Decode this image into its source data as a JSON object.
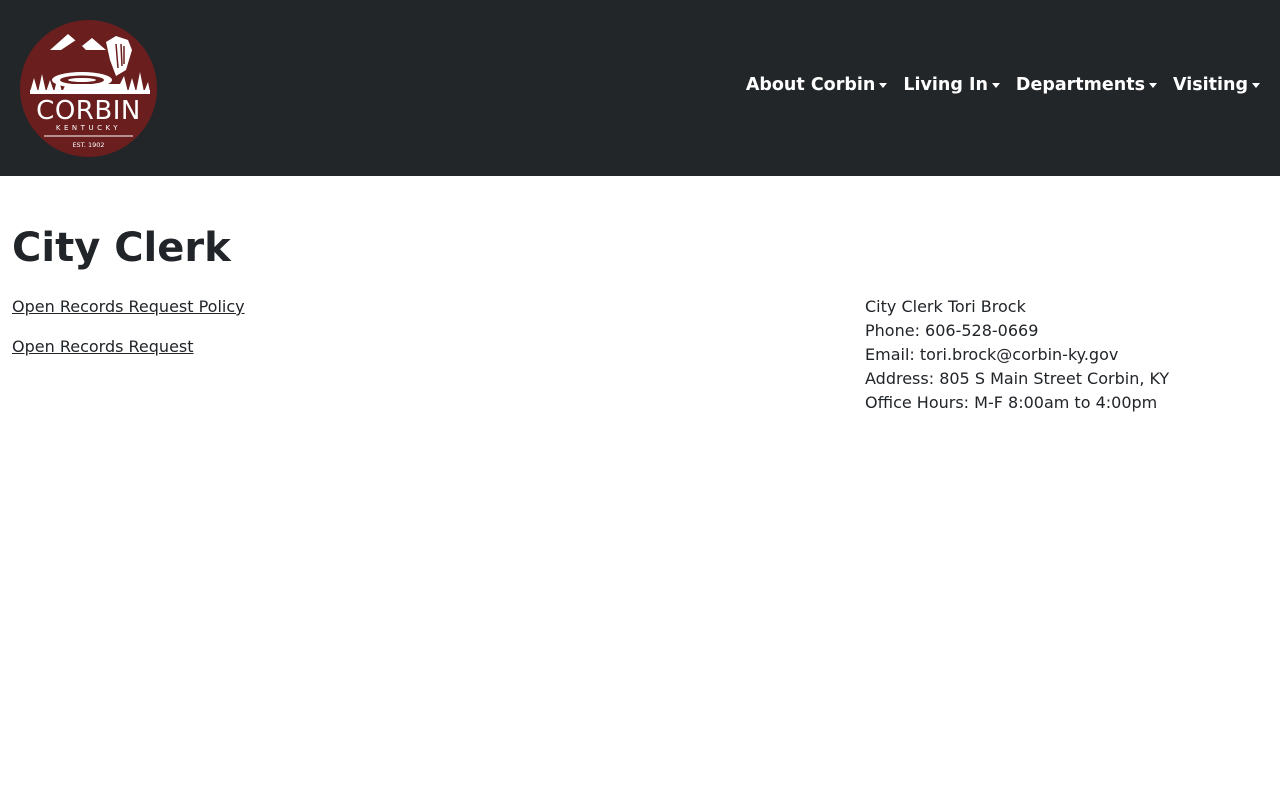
{
  "header": {
    "logo": {
      "city": "CORBIN",
      "state": "KENTUCKY",
      "est": "EST. 1902",
      "colors": {
        "background": "#6b1e1e",
        "foreground": "#ffffff"
      }
    },
    "nav": [
      {
        "label": "About Corbin"
      },
      {
        "label": "Living In"
      },
      {
        "label": "Departments"
      },
      {
        "label": "Visiting"
      }
    ],
    "colors": {
      "background": "#232629",
      "text": "#ffffff"
    }
  },
  "main": {
    "title": "City Clerk",
    "links": [
      {
        "label": "Open Records Request Policy"
      },
      {
        "label": "Open Records Request"
      }
    ],
    "contact": {
      "name": "City Clerk Tori Brock",
      "phone": "Phone: 606-528-0669",
      "email": "Email: tori.brock@corbin-ky.gov",
      "address": "Address: 805 S Main Street Corbin, KY",
      "hours": "Office Hours: M-F 8:00am to 4:00pm"
    }
  }
}
